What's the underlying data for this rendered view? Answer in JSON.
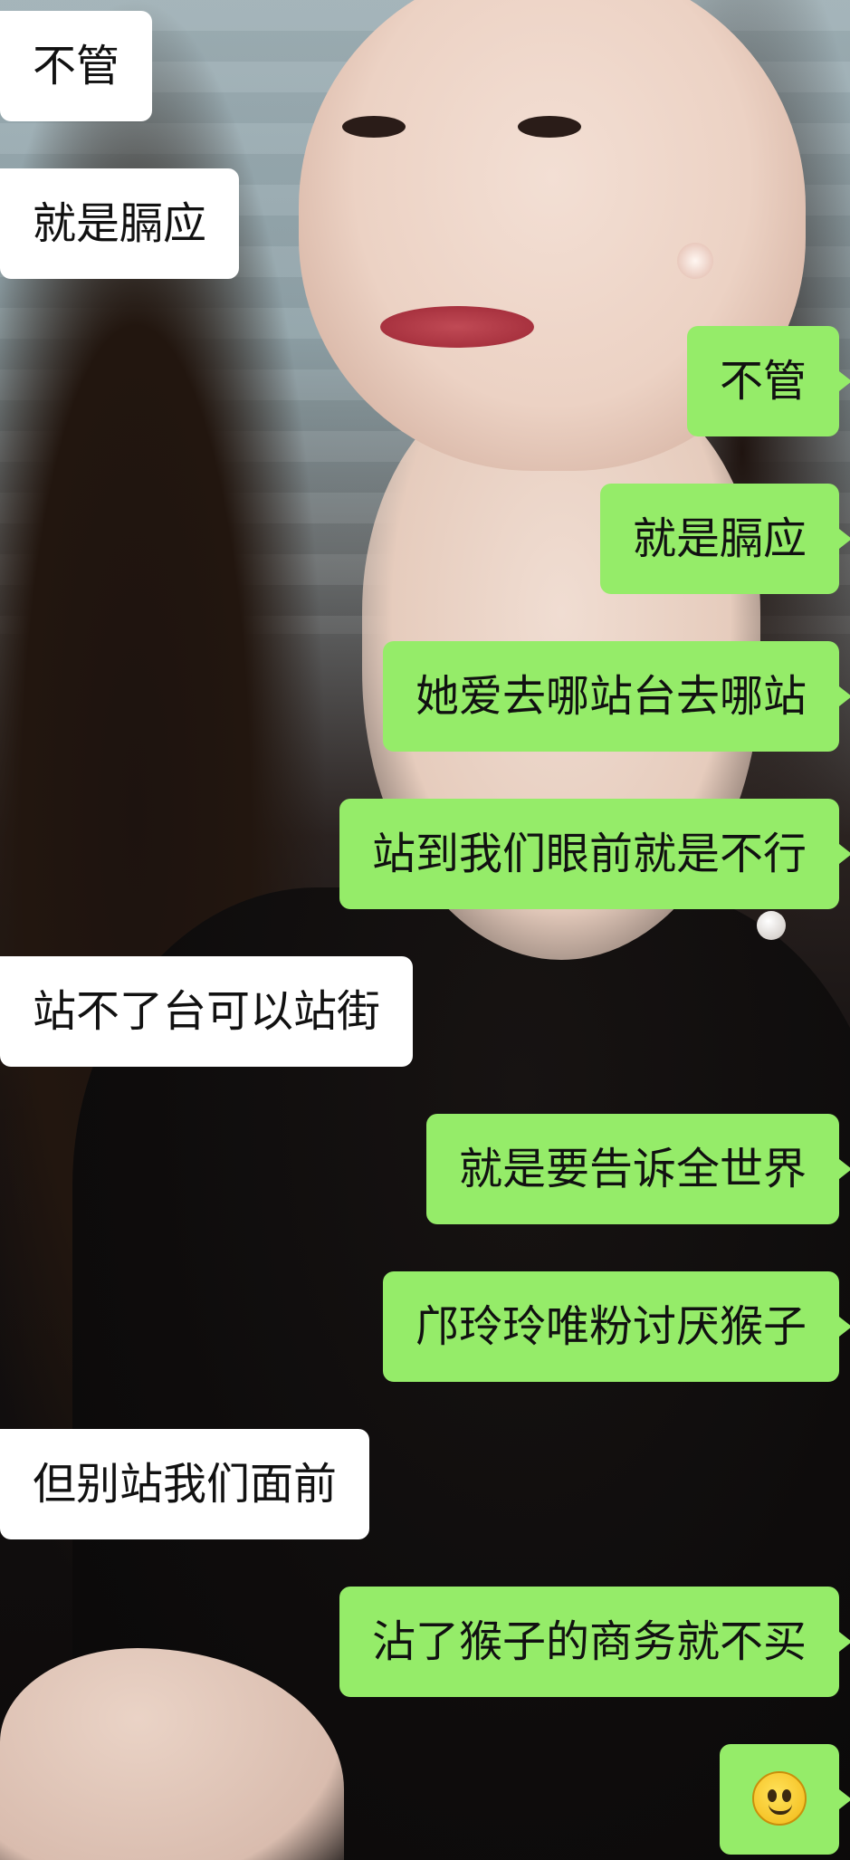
{
  "messages": [
    {
      "side": "in",
      "text": "不管"
    },
    {
      "side": "in",
      "text": "就是膈应"
    },
    {
      "side": "out",
      "text": "不管"
    },
    {
      "side": "out",
      "text": "就是膈应"
    },
    {
      "side": "out",
      "text": "她爱去哪站台去哪站"
    },
    {
      "side": "out",
      "text": "站到我们眼前就是不行"
    },
    {
      "side": "in",
      "text": "站不了台可以站街"
    },
    {
      "side": "out",
      "text": "就是要告诉全世界"
    },
    {
      "side": "out",
      "text": "邝玲玲唯粉讨厌猴子"
    },
    {
      "side": "in",
      "text": "但别站我们面前"
    },
    {
      "side": "out",
      "text": "沾了猴子的商务就不买"
    },
    {
      "side": "out",
      "icon": "smiley-emoji-icon"
    }
  ],
  "colors": {
    "incoming_bubble": "#ffffff",
    "outgoing_bubble": "#95ec69",
    "text": "#111111"
  }
}
